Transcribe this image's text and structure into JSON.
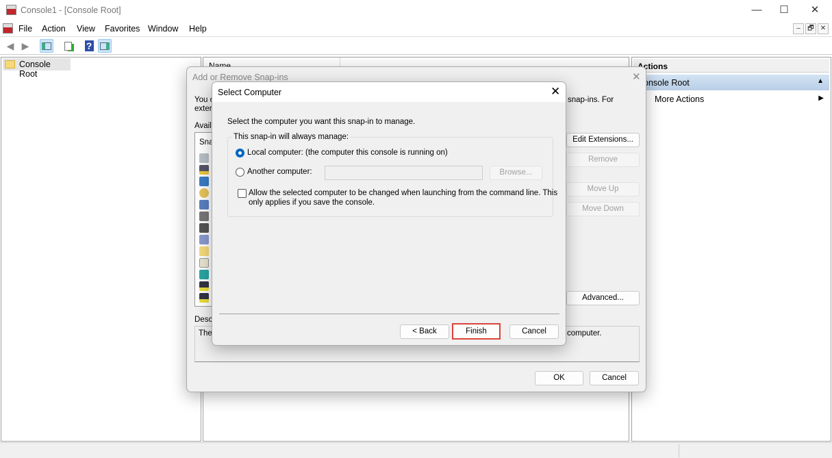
{
  "window": {
    "title": "Console1 - [Console Root]",
    "minimize": "—",
    "maximize": "☐",
    "close": "✕"
  },
  "menu": [
    "File",
    "Action",
    "View",
    "Favorites",
    "Window",
    "Help"
  ],
  "mdi_controls": [
    "–",
    "🗗",
    "✕"
  ],
  "toolbar": {
    "icons": [
      "back-arrow-icon",
      "forward-arrow-icon",
      "show-hide-console-tree-icon",
      "export-list-icon",
      "help-icon",
      "show-hide-action-pane-icon"
    ],
    "help_glyph": "?"
  },
  "tree": {
    "root": "Console Root"
  },
  "middle": {
    "column_header": "Name"
  },
  "actions": {
    "header": "Actions",
    "section": "Console Root",
    "item": "More Actions"
  },
  "snapins_dialog": {
    "title": "Add or Remove Snap-ins",
    "intro_line1_left": "You c",
    "intro_line1_right": "snap-ins. For",
    "intro_line2_left": "exter",
    "available_label": "Availa",
    "list_header": "Sna",
    "buttons": {
      "edit_extensions": "Edit Extensions...",
      "remove": "Remove",
      "move_up": "Move Up",
      "move_down": "Move Down",
      "advanced": "Advanced...",
      "ok": "OK",
      "cancel": "Cancel"
    },
    "description_label": "Descr",
    "description_left": "The",
    "description_right": "computer."
  },
  "select_computer": {
    "title": "Select Computer",
    "prompt": "Select the computer you want this snap-in to manage.",
    "group_label": "This snap-in will always manage:",
    "local_label": "Local computer:  (the computer this console is running on)",
    "local_selected": true,
    "another_label": "Another computer:",
    "another_value": "",
    "browse": "Browse...",
    "allow_change_line1": "Allow the selected computer to be changed when launching from the command line.  This",
    "allow_change_line2": "only applies if you save the console.",
    "allow_change_checked": false,
    "buttons": {
      "back": "< Back",
      "finish": "Finish",
      "cancel": "Cancel"
    },
    "highlight_color": "#d9443c"
  },
  "colors": {
    "accent": "#0067c0",
    "selection": "#c4d9ee"
  }
}
